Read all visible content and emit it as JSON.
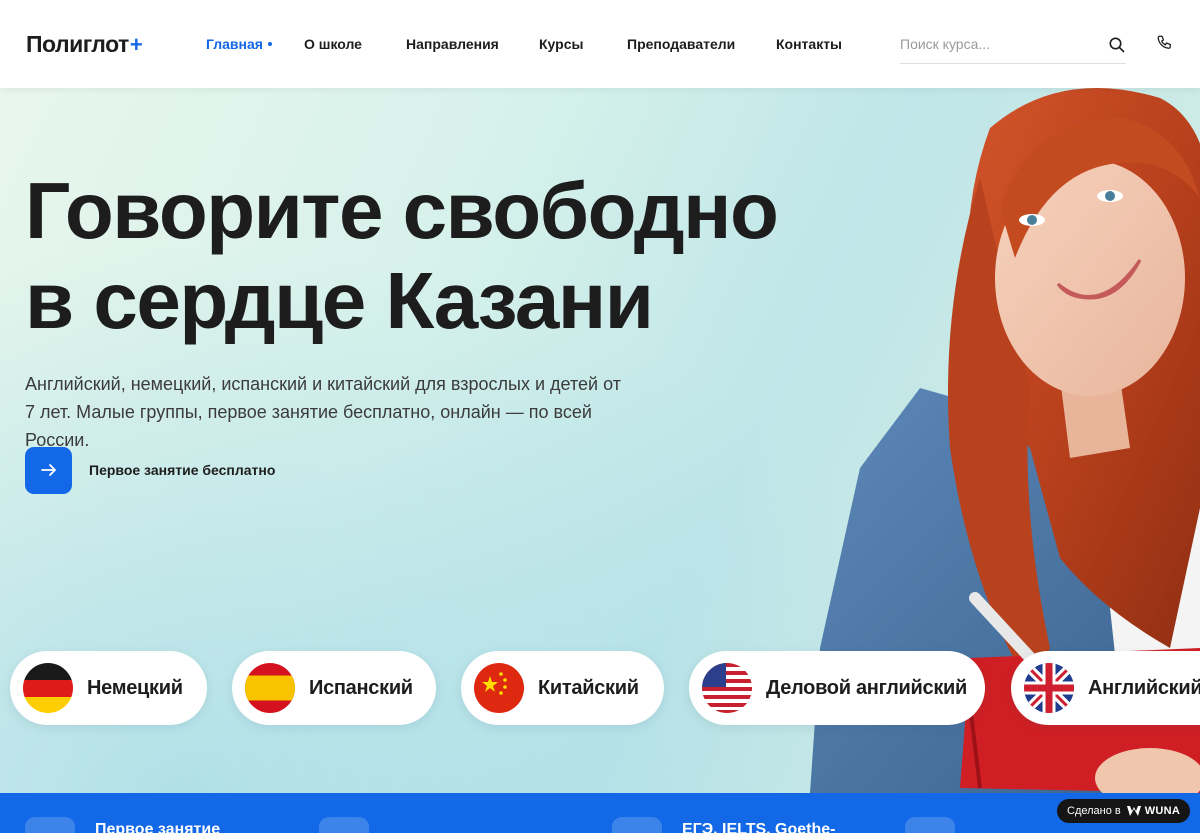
{
  "header": {
    "logo": "Полиглот",
    "logo_plus": "+",
    "nav": [
      {
        "label": "Главная",
        "active": true
      },
      {
        "label": "О школе"
      },
      {
        "label": "Направления"
      },
      {
        "label": "Курсы"
      },
      {
        "label": "Преподаватели"
      },
      {
        "label": "Контакты"
      }
    ],
    "search_placeholder": "Поиск курса...",
    "accent_color": "#1268e6"
  },
  "hero": {
    "title_line1": "Говорите свободно",
    "title_line2": "в сердце Казани",
    "description": "Английский, немецкий, испанский и китайский для взрослых и детей от 7 лет. Малые группы, первое занятие бесплатно, онлайн — по всей России.",
    "cta_label": "Первое занятие бесплатно",
    "languages": [
      {
        "label": "Немецкий",
        "flag": "germany-flag-icon"
      },
      {
        "label": "Испанский",
        "flag": "spain-flag-icon"
      },
      {
        "label": "Китайский",
        "flag": "china-flag-icon"
      },
      {
        "label": "Деловой английский",
        "flag": "usa-flag-icon"
      },
      {
        "label": "Английский",
        "flag": "uk-flag-icon"
      }
    ]
  },
  "features": [
    {
      "label": "Первое занятие"
    },
    {
      "label": "ЕГЭ, IELTS, Goethe-"
    }
  ],
  "badge": {
    "prefix": "Сделано в",
    "brand": "WUNA"
  }
}
